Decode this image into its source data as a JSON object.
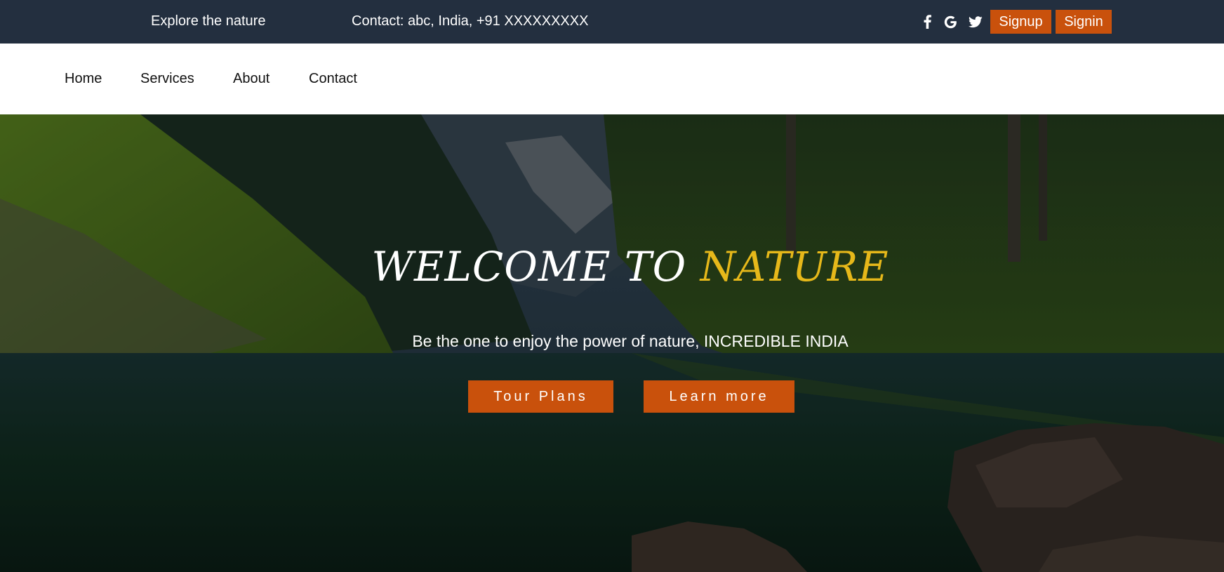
{
  "topbar": {
    "tagline": "Explore the nature",
    "contact": "Contact: abc, India, +91 XXXXXXXXX",
    "social": [
      "facebook-icon",
      "google-icon",
      "twitter-icon"
    ],
    "signup_label": "Signup",
    "signin_label": "Signin"
  },
  "nav": {
    "items": [
      {
        "label": "Home"
      },
      {
        "label": "Services"
      },
      {
        "label": "About"
      },
      {
        "label": "Contact"
      }
    ]
  },
  "hero": {
    "title_prefix": "WELCOME TO ",
    "title_accent": "NATURE",
    "subtitle": "Be the one to enjoy the power of nature, INCREDIBLE INDIA",
    "primary_button": "Tour Plans",
    "secondary_button": "Learn more"
  },
  "colors": {
    "topbar_bg": "#232f3f",
    "accent_button": "#c9510c",
    "title_accent": "#e6b81a"
  }
}
